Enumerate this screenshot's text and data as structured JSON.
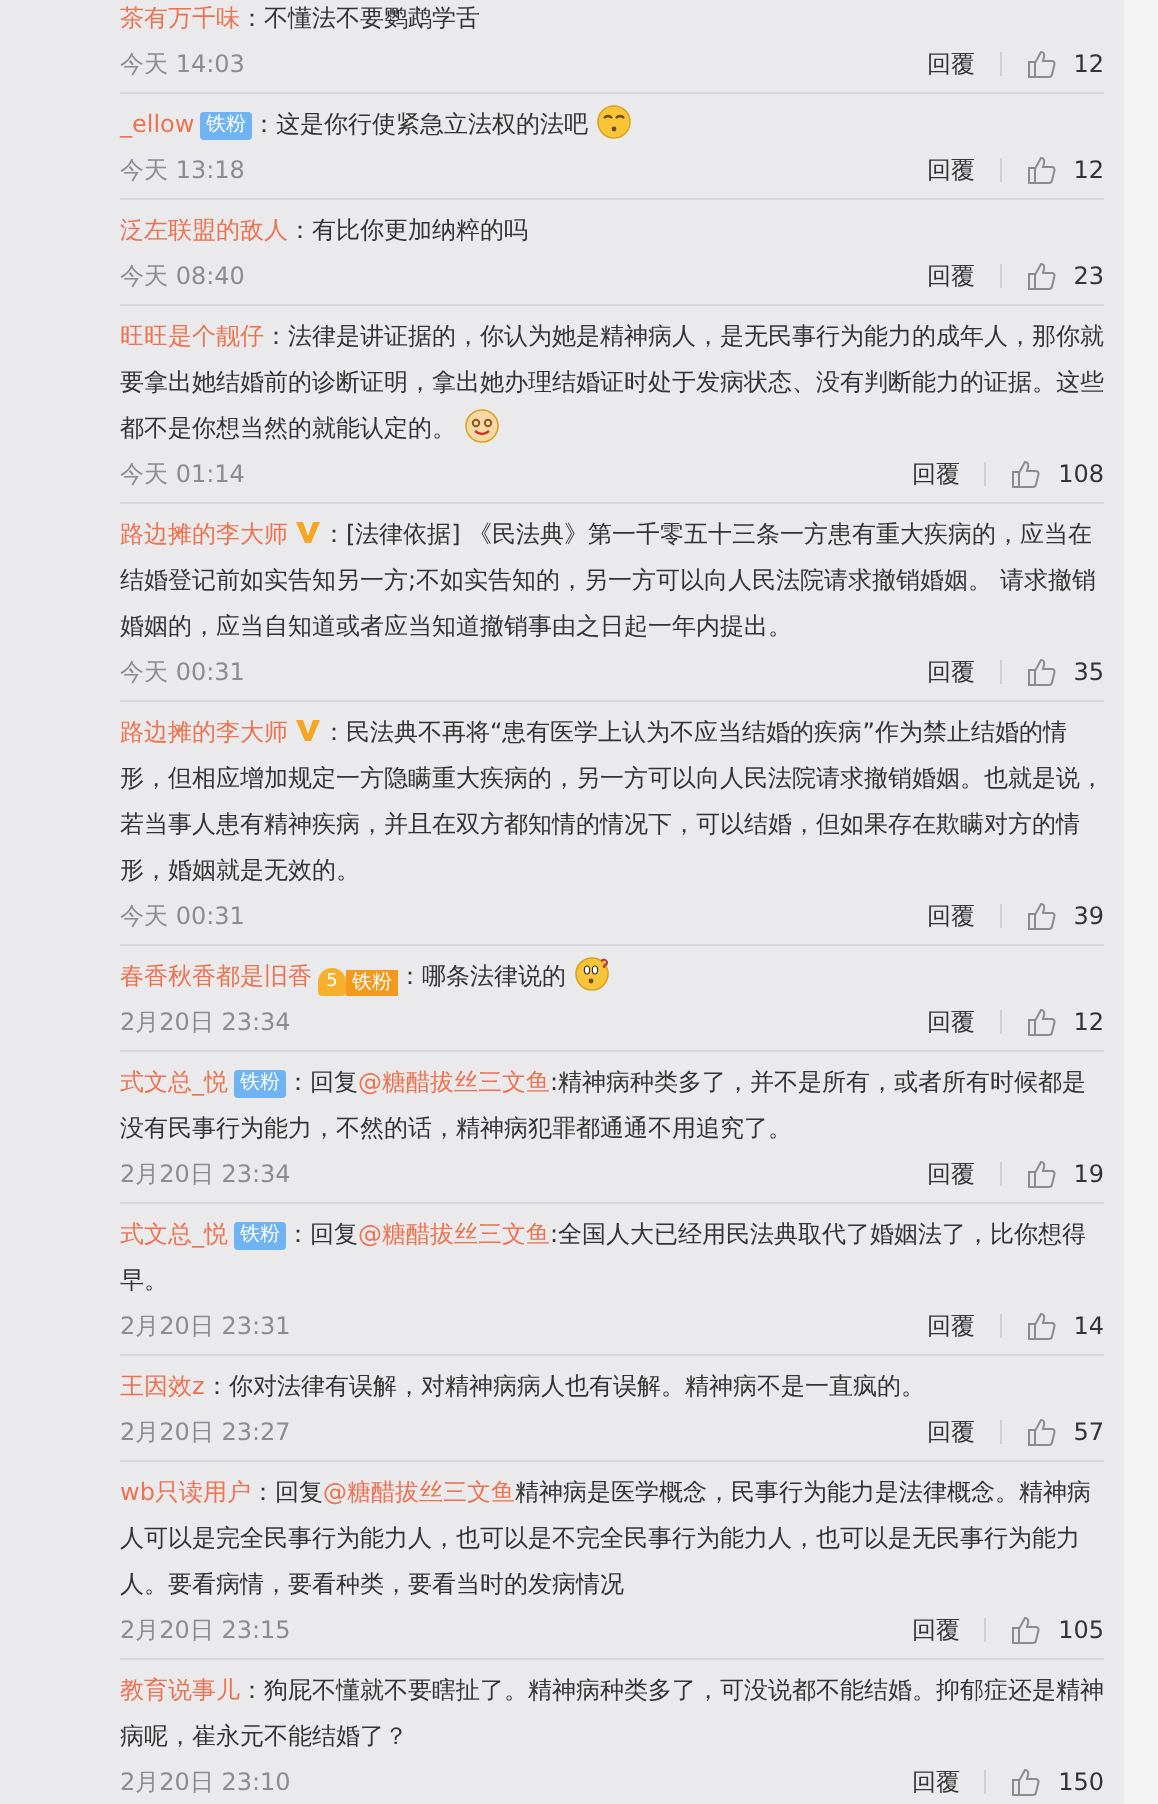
{
  "comments": [
    {
      "user": "茶有万千味",
      "sep": "：",
      "text": "不懂法不要鹦鹉学舌",
      "time": "今天 14:03",
      "reply": "回覆",
      "likes": "12"
    },
    {
      "user": "_ellow",
      "badge": {
        "kind": "fan",
        "label": "铁粉"
      },
      "sep": "：",
      "text": "这是你行使紧急立法权的法吧",
      "emoji": {
        "kind": "sleepy"
      },
      "time": "今天 13:18",
      "reply": "回覆",
      "likes": "12"
    },
    {
      "user": "泛左联盟的敌人",
      "sep": "：",
      "text": "有比你更加纳粹的吗",
      "time": "今天 08:40",
      "reply": "回覆",
      "likes": "23"
    },
    {
      "user": "旺旺是个靓仔",
      "sep": "：",
      "text": "法律是讲证据的，你认为她是精神病人，是无民事行为能力的成年人，那你就要拿出她结婚前的诊断证明，拿出她办理结婚证时处于发病状态、没有判断能力的证据。这些都不是你想当然的就能认定的。",
      "emoji": {
        "kind": "smile"
      },
      "time": "今天 01:14",
      "reply": "回覆",
      "likes": "108"
    },
    {
      "user": "路边摊的李大师",
      "badge": {
        "kind": "verified"
      },
      "sep": "：",
      "text": "[法律依据] 《民法典》第一千零五十三条一方患有重大疾病的，应当在结婚登记前如实告知另一方;不如实告知的，另一方可以向人民法院请求撤销婚姻。 请求撤销婚姻的，应当自知道或者应当知道撤销事由之日起一年内提出。",
      "time": "今天 00:31",
      "reply": "回覆",
      "likes": "35"
    },
    {
      "user": "路边摊的李大师",
      "badge": {
        "kind": "verified"
      },
      "sep": "：",
      "text": "民法典不再将“患有医学上认为不应当结婚的疾病”作为禁止结婚的情形，但相应增加规定一方隐瞒重大疾病的，另一方可以向人民法院请求撤销婚姻。也就是说，若当事人患有精神疾病，并且在双方都知情的情况下，可以结婚，但如果存在欺瞒对方的情形，婚姻就是无效的。",
      "time": "今天 00:31",
      "reply": "回覆",
      "likes": "39"
    },
    {
      "user": "春香秋香都是旧香",
      "badge": {
        "kind": "crown_fan",
        "rank": "5",
        "label": "铁粉"
      },
      "sep": "：",
      "text": "哪条法律说的",
      "emoji": {
        "kind": "wonder"
      },
      "time": "2月20日 23:34",
      "reply": "回覆",
      "likes": "12"
    },
    {
      "user": "式文总_悦",
      "badge": {
        "kind": "fan",
        "label": "铁粉"
      },
      "sep": "：",
      "reply_prefix": "回复",
      "mention": "@糖醋拔丝三文鱼",
      "text": ":精神病种类多了，并不是所有，或者所有时候都是没有民事行为能力，不然的话，精神病犯罪都通通不用追究了。",
      "time": "2月20日 23:34",
      "reply": "回覆",
      "likes": "19"
    },
    {
      "user": "式文总_悦",
      "badge": {
        "kind": "fan",
        "label": "铁粉"
      },
      "sep": "：",
      "reply_prefix": "回复",
      "mention": "@糖醋拔丝三文鱼",
      "text": ":全国人大已经用民法典取代了婚姻法了，比你想得早。",
      "time": "2月20日 23:31",
      "reply": "回覆",
      "likes": "14"
    },
    {
      "user": "王因效z",
      "sep": "：",
      "text": "你对法律有误解，对精神病病人也有误解。精神病不是一直疯的。",
      "time": "2月20日 23:27",
      "reply": "回覆",
      "likes": "57"
    },
    {
      "user": "wb只读用户",
      "sep": "：",
      "reply_prefix": "回复",
      "mention": "@糖醋拔丝三文鱼",
      "text": "精神病是医学概念，民事行为能力是法律概念。精神病人可以是完全民事行为能力人，也可以是不完全民事行为能力人，也可以是无民事行为能力人。要看病情，要看种类，要看当时的发病情况",
      "time": "2月20日 23:15",
      "reply": "回覆",
      "likes": "105"
    },
    {
      "user": "教育说事儿",
      "sep": "：",
      "text": "狗屁不懂就不要瞎扯了。精神病种类多了，可没说都不能结婚。抑郁症还是精神病呢，崔永元不能结婚了？",
      "time": "2月20日 23:10",
      "reply": "回覆",
      "likes": "150"
    }
  ]
}
